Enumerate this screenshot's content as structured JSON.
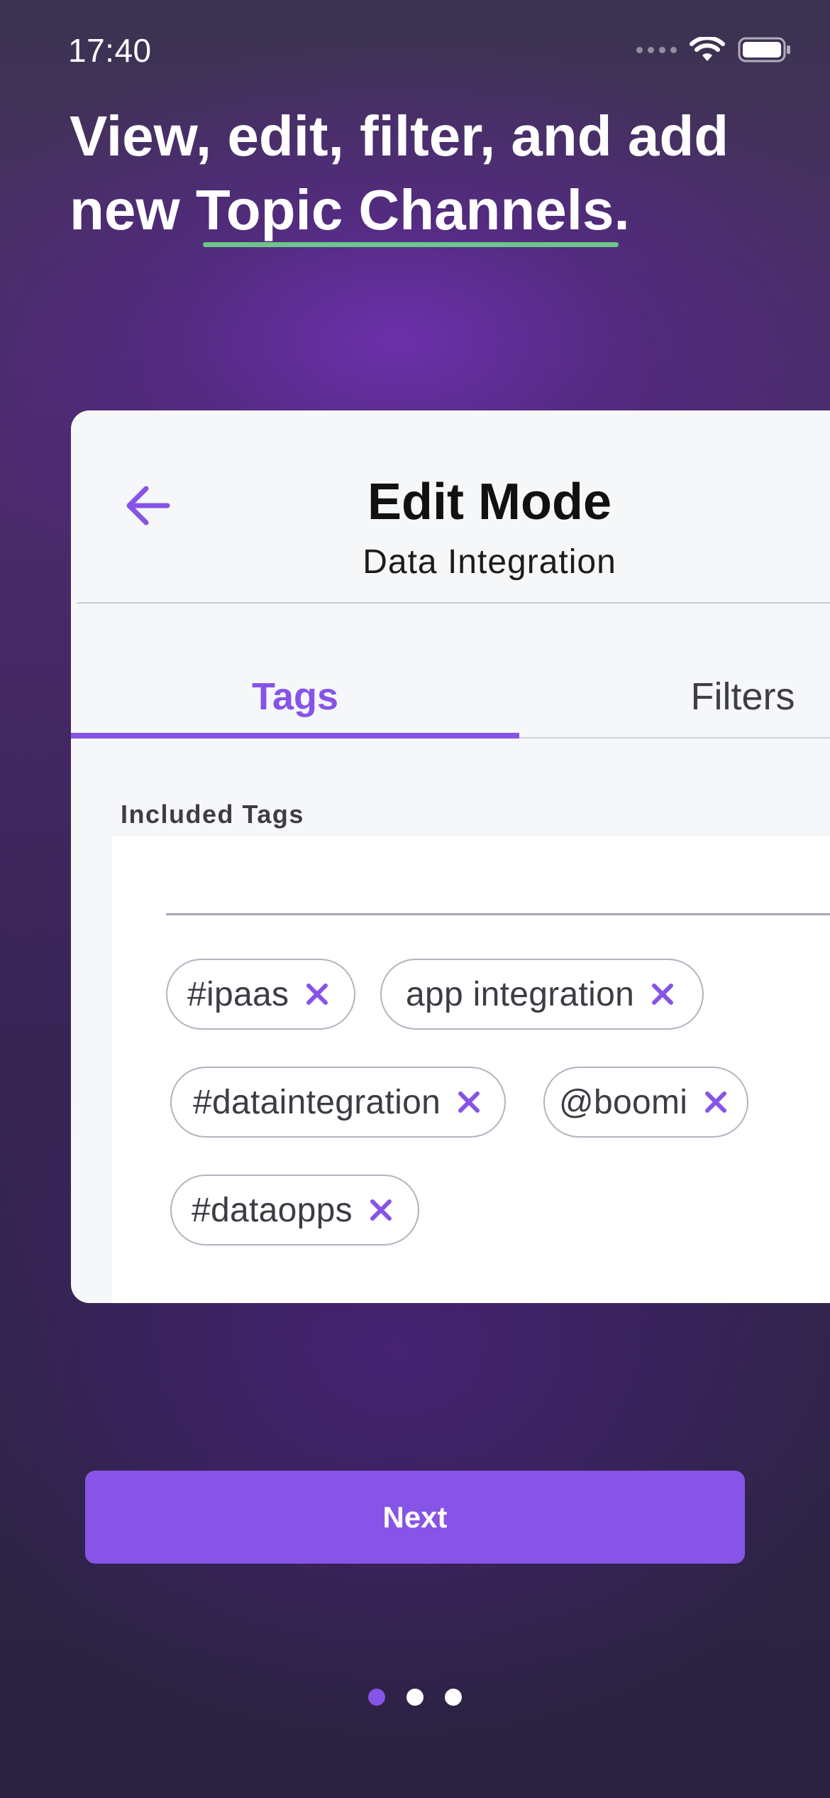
{
  "status_bar": {
    "time": "17:40",
    "wifi_icon": "wifi-icon",
    "battery_icon": "battery-icon"
  },
  "headline": {
    "text_before": "View, edit, filter, and add new ",
    "highlight": "Topic Channels",
    "text_after": "."
  },
  "card": {
    "back_icon": "arrow-left-icon",
    "title": "Edit Mode",
    "subtitle": "Data Integration",
    "tabs": [
      {
        "label": "Tags",
        "active": true
      },
      {
        "label": "Filters",
        "active": false
      }
    ],
    "section_label": "Included Tags",
    "tags": [
      {
        "label": "#ipaas"
      },
      {
        "label": "app integration"
      },
      {
        "label": "#dataintegration"
      },
      {
        "label": "@boomi"
      },
      {
        "label": "#dataopps"
      }
    ],
    "remove_icon": "close-icon"
  },
  "next_button": {
    "label": "Next"
  },
  "pagination": {
    "total": 3,
    "current": 1
  },
  "colors": {
    "accent": "#8654e6",
    "highlight_underline": "#6cc58a",
    "card_bg": "#f6f7f9"
  }
}
